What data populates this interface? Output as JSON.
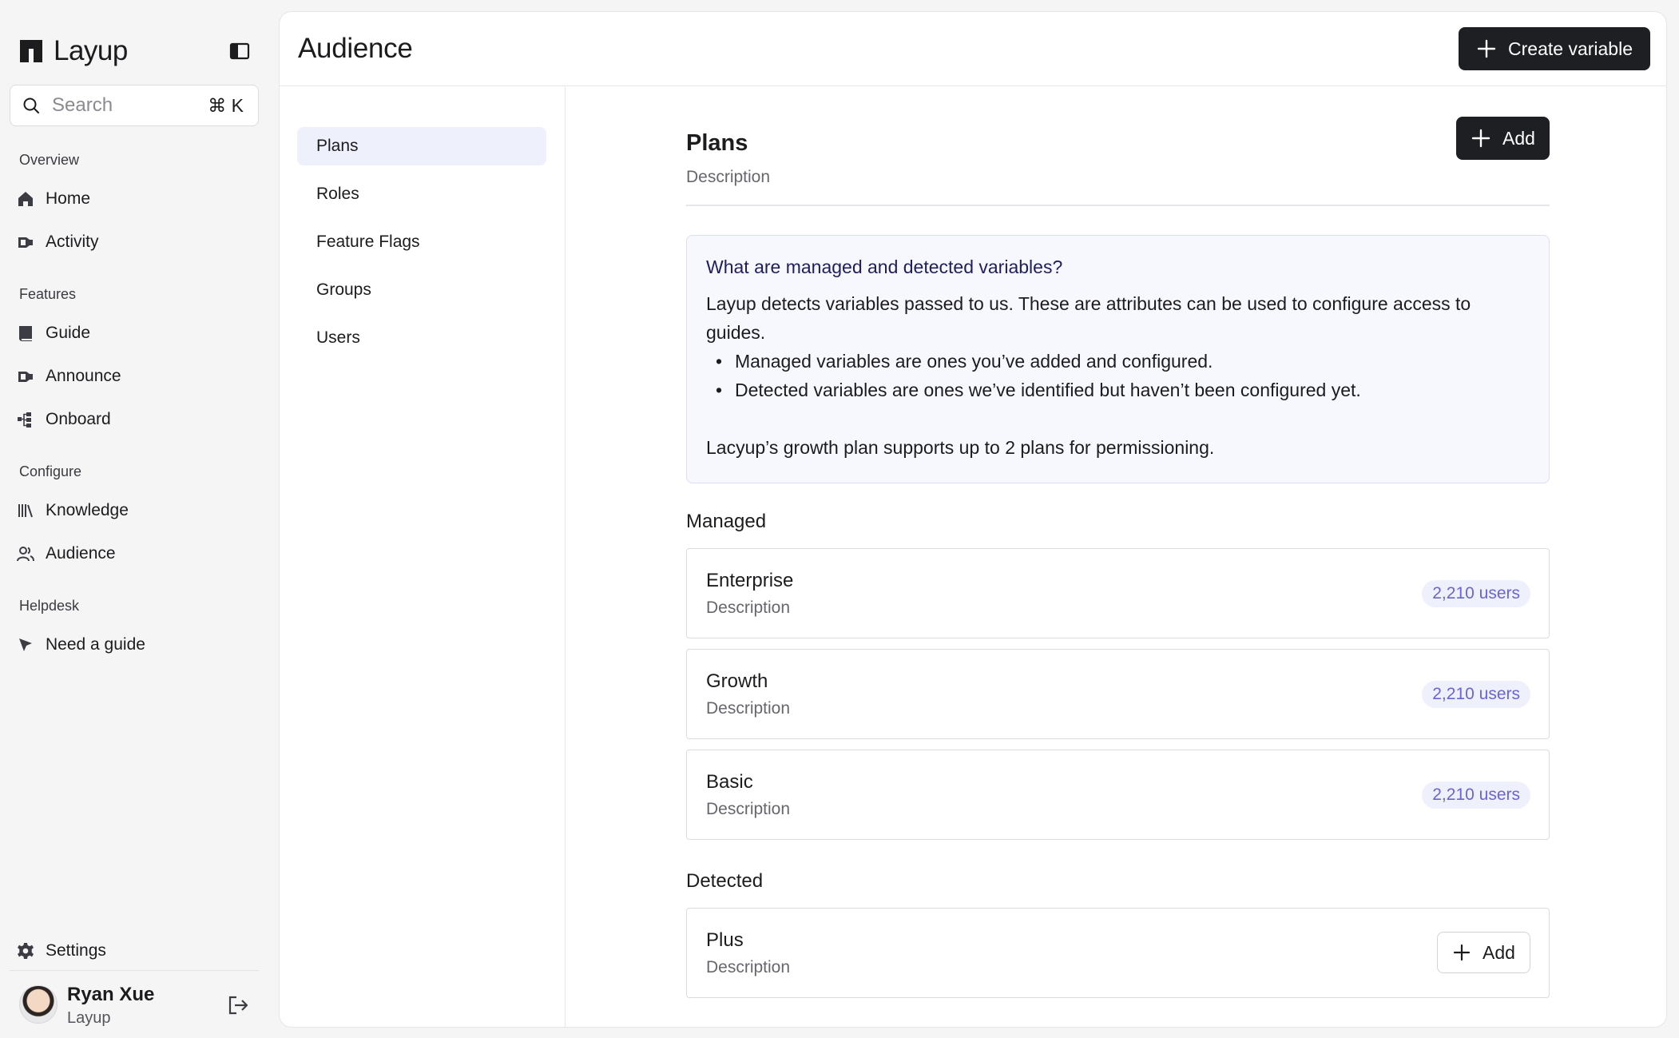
{
  "app": {
    "name": "Layup"
  },
  "search": {
    "placeholder": "Search",
    "shortcut": "⌘ K"
  },
  "sidebar": {
    "sections": [
      {
        "label": "Overview",
        "items": [
          {
            "label": "Home",
            "icon": "home-icon"
          },
          {
            "label": "Activity",
            "icon": "activity-icon"
          }
        ]
      },
      {
        "label": "Features",
        "items": [
          {
            "label": "Guide",
            "icon": "book-icon"
          },
          {
            "label": "Announce",
            "icon": "megaphone-icon"
          },
          {
            "label": "Onboard",
            "icon": "workflow-icon"
          }
        ]
      },
      {
        "label": "Configure",
        "items": [
          {
            "label": "Knowledge",
            "icon": "library-icon"
          },
          {
            "label": "Audience",
            "icon": "users-icon"
          }
        ]
      },
      {
        "label": "Helpdesk",
        "items": [
          {
            "label": "Need a guide",
            "icon": "cursor-icon"
          }
        ]
      }
    ],
    "settings": {
      "label": "Settings",
      "icon": "gear-icon"
    }
  },
  "user": {
    "name": "Ryan Xue",
    "org": "Layup"
  },
  "page": {
    "title": "Audience",
    "create_label": "Create variable"
  },
  "subnav": {
    "active": "Plans",
    "items": [
      "Plans",
      "Roles",
      "Feature Flags",
      "Groups",
      "Users"
    ]
  },
  "section": {
    "title": "Plans",
    "description": "Description",
    "add_label": "Add"
  },
  "info": {
    "title": "What are managed and detected variables?",
    "body": "Layup detects variables passed to us. These are attributes can be used to configure access to guides.",
    "bullets": [
      "Managed variables are ones you’ve added and configured.",
      "Detected variables are ones we’ve identified but haven’t been configured yet."
    ],
    "note": "Lacyup’s growth plan supports up to 2 plans for permissioning."
  },
  "managed": {
    "label": "Managed",
    "items": [
      {
        "name": "Enterprise",
        "description": "Description",
        "count": "2,210 users"
      },
      {
        "name": "Growth",
        "description": "Description",
        "count": "2,210 users"
      },
      {
        "name": "Basic",
        "description": "Description",
        "count": "2,210 users"
      }
    ]
  },
  "detected": {
    "label": "Detected",
    "items": [
      {
        "name": "Plus",
        "description": "Description",
        "action": "Add"
      }
    ]
  },
  "colors": {
    "accent_bg": "#eef0fb",
    "accent_text": "#6a64d6",
    "dark_button": "#1e1f22",
    "info_title": "#1f1d5c"
  }
}
